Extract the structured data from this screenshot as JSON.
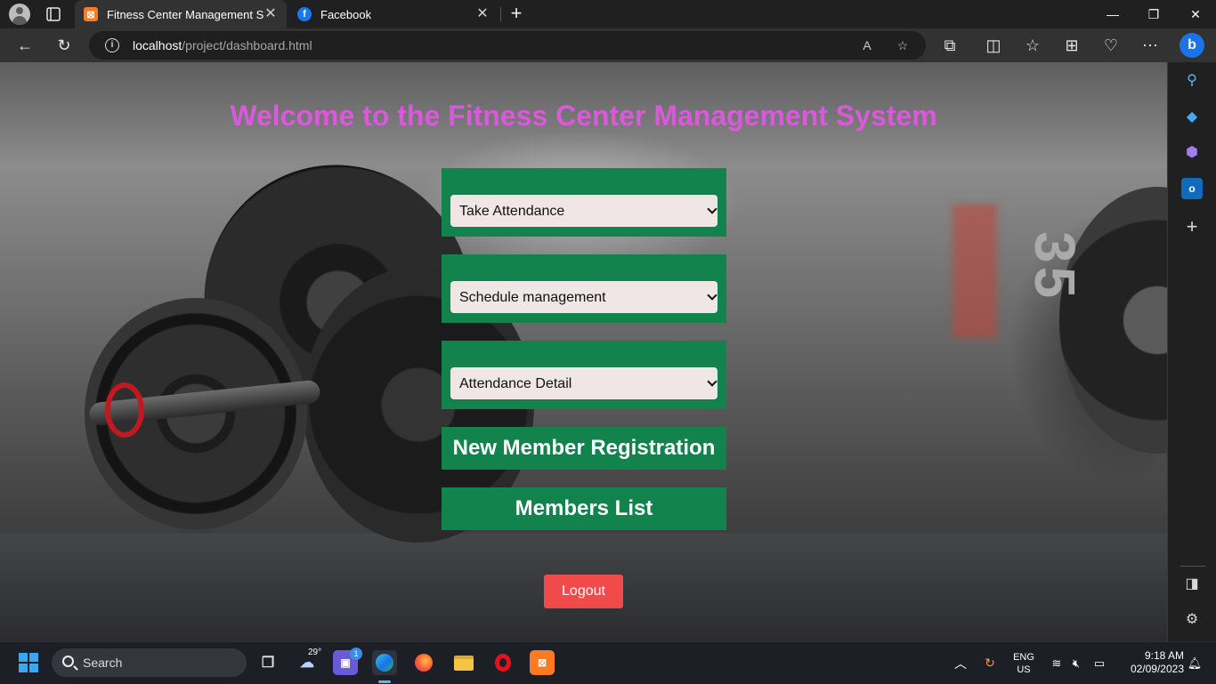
{
  "browser": {
    "tabs": [
      {
        "title": "Fitness Center Management System",
        "favicon": "xampp-icon",
        "active": true
      },
      {
        "title": "Facebook",
        "favicon": "facebook-icon",
        "active": false
      }
    ],
    "address": {
      "host": "localhost",
      "path": "/project/dashboard.html"
    },
    "bing_label": "b"
  },
  "page": {
    "title": "Welcome to the Fitness Center Management System",
    "selects": [
      {
        "value": "Take Attendance"
      },
      {
        "value": "Schedule management"
      },
      {
        "value": "Attendance Detail"
      }
    ],
    "buttons": {
      "registration": "New Member Registration",
      "members": "Members List",
      "logout": "Logout"
    },
    "background_plate_number": "35",
    "colors": {
      "panel": "#13834e",
      "title": "#d95ad9",
      "logout": "#f04a4a"
    }
  },
  "taskbar": {
    "search_placeholder": "Search",
    "weather_temp": "29°",
    "chat_badge": "1",
    "language": "ENG",
    "region": "US",
    "time": "9:18 AM",
    "date": "02/09/2023"
  }
}
